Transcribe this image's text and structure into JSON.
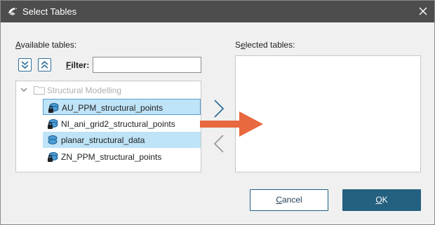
{
  "window": {
    "title": "Select Tables",
    "app_icon": "leapfrog-icon",
    "close_icon": "close-icon"
  },
  "available": {
    "label_prefix": "",
    "label_underlined": "A",
    "label_rest": "vailable tables:",
    "expand_all_icon": "chevron-double-down-icon",
    "collapse_all_icon": "chevron-double-up-icon",
    "filter_label_underlined": "F",
    "filter_label_rest": "ilter:",
    "filter_value": "",
    "tree": {
      "group_label": "Structural Modelling",
      "items": [
        {
          "label": "AU_PPM_structural_points",
          "icon": "locked-structural-points-icon",
          "selected": true
        },
        {
          "label": "NI_ani_grid2_structural_points",
          "icon": "locked-structural-points-icon",
          "selected": false
        },
        {
          "label": "planar_structural_data",
          "icon": "structural-data-icon",
          "selected": true
        },
        {
          "label": "ZN_PPM_structural_points",
          "icon": "locked-structural-points-icon",
          "selected": false
        }
      ]
    }
  },
  "selected": {
    "label_prefix": "S",
    "label_underlined": "e",
    "label_rest": "lected tables:"
  },
  "transfer": {
    "add_icon": "chevron-right-icon",
    "remove_icon": "chevron-left-icon"
  },
  "annotation": {
    "arrow_color": "#e8683f"
  },
  "buttons": {
    "cancel_underlined": "C",
    "cancel_rest": "ancel",
    "ok_underlined": "O",
    "ok_rest": "K"
  },
  "colors": {
    "titlebar": "#4d4d4d",
    "selection": "#bfe3f7",
    "primary_button": "#24607f",
    "accent": "#2f6f97"
  }
}
